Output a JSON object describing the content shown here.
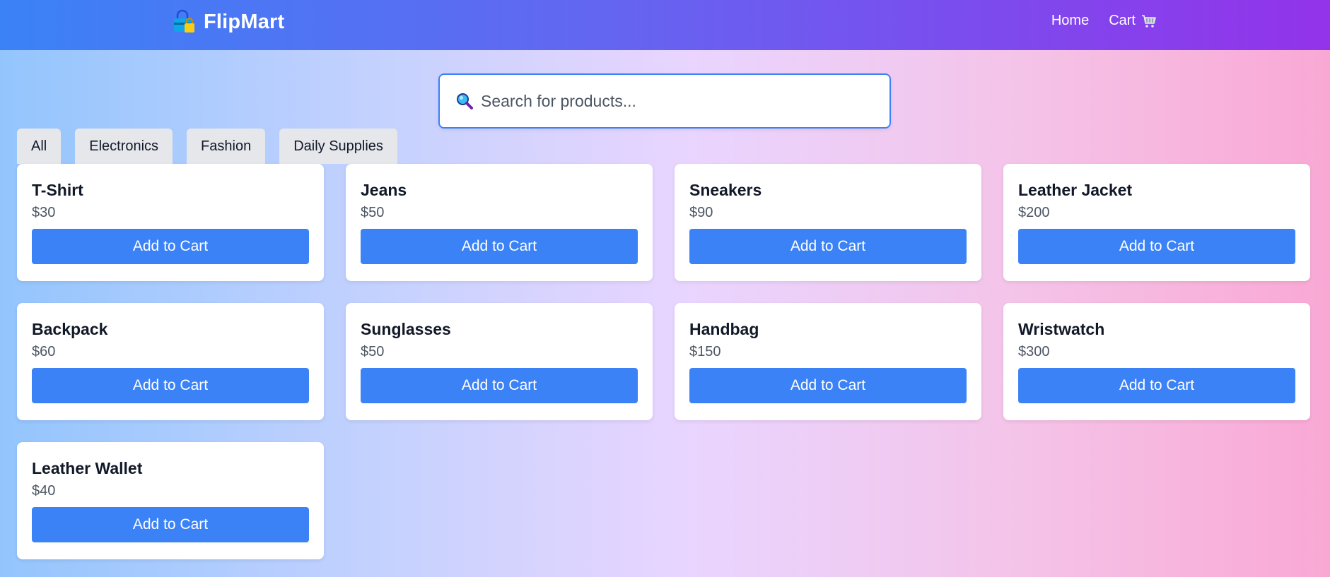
{
  "app": {
    "brand_name": "FlipMart",
    "brand_icon": "shopping-bag-lock-icon"
  },
  "nav": {
    "home_label": "Home",
    "cart_label": "Cart",
    "cart_icon": "shopping-cart-icon"
  },
  "search": {
    "placeholder": "Search for products...",
    "value": "",
    "icon": "magnifying-glass-icon"
  },
  "filters": [
    {
      "label": "All"
    },
    {
      "label": "Electronics"
    },
    {
      "label": "Fashion"
    },
    {
      "label": "Daily Supplies"
    }
  ],
  "products": [
    {
      "name": "T-Shirt",
      "price": "$30",
      "button": "Add to Cart"
    },
    {
      "name": "Jeans",
      "price": "$50",
      "button": "Add to Cart"
    },
    {
      "name": "Sneakers",
      "price": "$90",
      "button": "Add to Cart"
    },
    {
      "name": "Leather Jacket",
      "price": "$200",
      "button": "Add to Cart"
    },
    {
      "name": "Backpack",
      "price": "$60",
      "button": "Add to Cart"
    },
    {
      "name": "Sunglasses",
      "price": "$50",
      "button": "Add to Cart"
    },
    {
      "name": "Handbag",
      "price": "$150",
      "button": "Add to Cart"
    },
    {
      "name": "Wristwatch",
      "price": "$300",
      "button": "Add to Cart"
    },
    {
      "name": "Leather Wallet",
      "price": "$40",
      "button": "Add to Cart"
    }
  ],
  "colors": {
    "accent": "#3b82f6",
    "header_start": "#3b82f6",
    "header_end": "#9333ea",
    "filter_bg": "#e5e7eb"
  }
}
